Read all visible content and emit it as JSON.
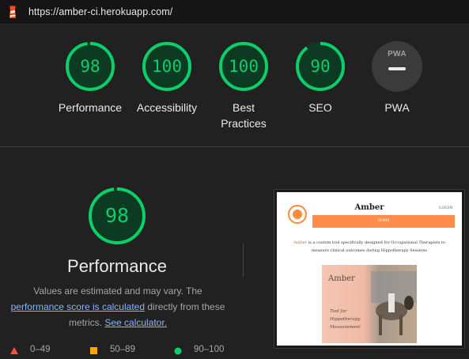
{
  "address_bar": {
    "url": "https://amber-ci.herokuapp.com/"
  },
  "summary": [
    {
      "label_lines": [
        "Performance"
      ],
      "score": "98",
      "value": 98
    },
    {
      "label_lines": [
        "Accessibility"
      ],
      "score": "100",
      "value": 100
    },
    {
      "label_lines": [
        "Best",
        "Practices"
      ],
      "score": "100",
      "value": 100
    },
    {
      "label_lines": [
        "SEO"
      ],
      "score": "90",
      "value": 90
    }
  ],
  "pwa": {
    "badge_text": "PWA",
    "label": "PWA"
  },
  "performance": {
    "score": "98",
    "value": 98,
    "title": "Performance",
    "desc_prefix": "Values are estimated and may vary. The",
    "link_score": "performance score is calculated",
    "desc_mid": "directly from these metrics.",
    "link_calculator": "See calculator."
  },
  "legend": [
    {
      "range": "0–49",
      "shape": "triangle",
      "color": "#ff4e42"
    },
    {
      "range": "50–89",
      "shape": "square",
      "color": "#ffa400"
    },
    {
      "range": "90–100",
      "shape": "circle",
      "color": "#0cce6b"
    }
  ],
  "colors": {
    "pass": "#0cce6b",
    "pass_track": "#0d3a23",
    "background": "#212121"
  },
  "screenshot": {
    "site_title": "Amber",
    "login": "LOGIN",
    "nav_home": "HOME",
    "intro_name": "Amber",
    "intro_line1": "is a custom tool specifically designed for Occupational Therapists to",
    "intro_line2": "measure clinical outcomes during Hippotherapy Sessions",
    "hero_title": "Amber",
    "hero_sub": "Tool for Hippotherapy Measurement"
  }
}
